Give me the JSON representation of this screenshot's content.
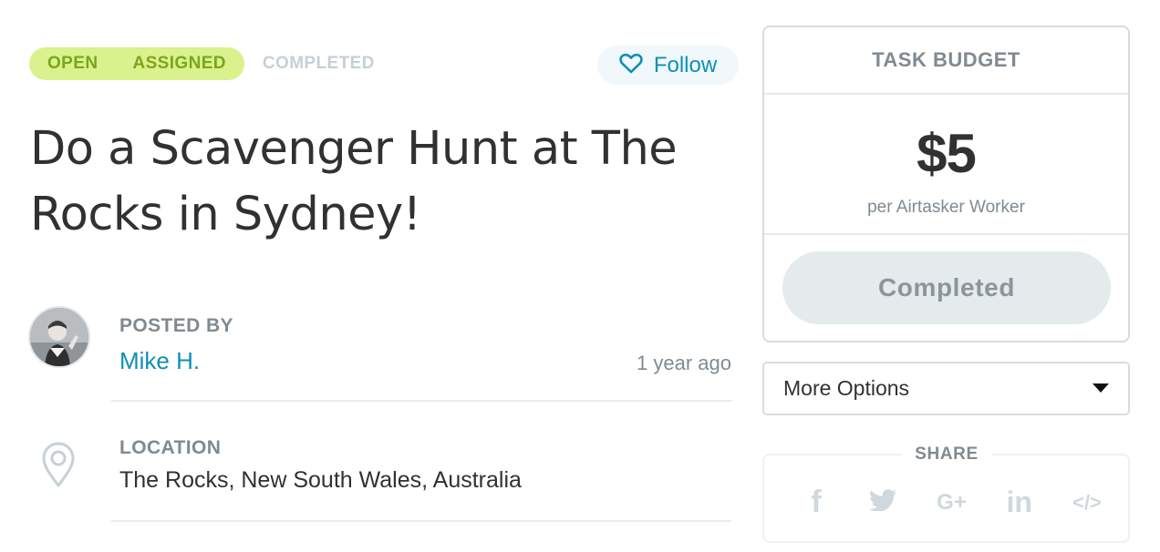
{
  "status": {
    "steps": [
      {
        "label": "OPEN",
        "active": true
      },
      {
        "label": "ASSIGNED",
        "active": true
      },
      {
        "label": "COMPLETED",
        "active": false
      }
    ]
  },
  "follow": {
    "label": "Follow",
    "icon": "heart-outline-icon"
  },
  "task": {
    "title": "Do a Scavenger Hunt at The Rocks in Sydney!"
  },
  "poster": {
    "section_label": "POSTED BY",
    "name": "Mike H.",
    "time": "1 year ago"
  },
  "location": {
    "section_label": "LOCATION",
    "value": "The Rocks, New South Wales, Australia",
    "icon": "map-pin-icon"
  },
  "budget": {
    "title": "TASK BUDGET",
    "amount": "$5",
    "subtitle": "per Airtasker Worker",
    "button_label": "Completed"
  },
  "more_options": {
    "label": "More Options",
    "icon": "caret-down-icon"
  },
  "share": {
    "title": "SHARE",
    "icons": [
      {
        "name": "facebook-icon",
        "glyph": "f"
      },
      {
        "name": "twitter-icon",
        "glyph": ""
      },
      {
        "name": "google-plus-icon",
        "glyph": "G+"
      },
      {
        "name": "linkedin-icon",
        "glyph": "in"
      },
      {
        "name": "embed-code-icon",
        "glyph": "</>"
      }
    ]
  },
  "colors": {
    "accent": "#0f8fb6",
    "status_bg": "#d9f28e",
    "status_text": "#7da51b",
    "muted": "#7f8a92"
  }
}
